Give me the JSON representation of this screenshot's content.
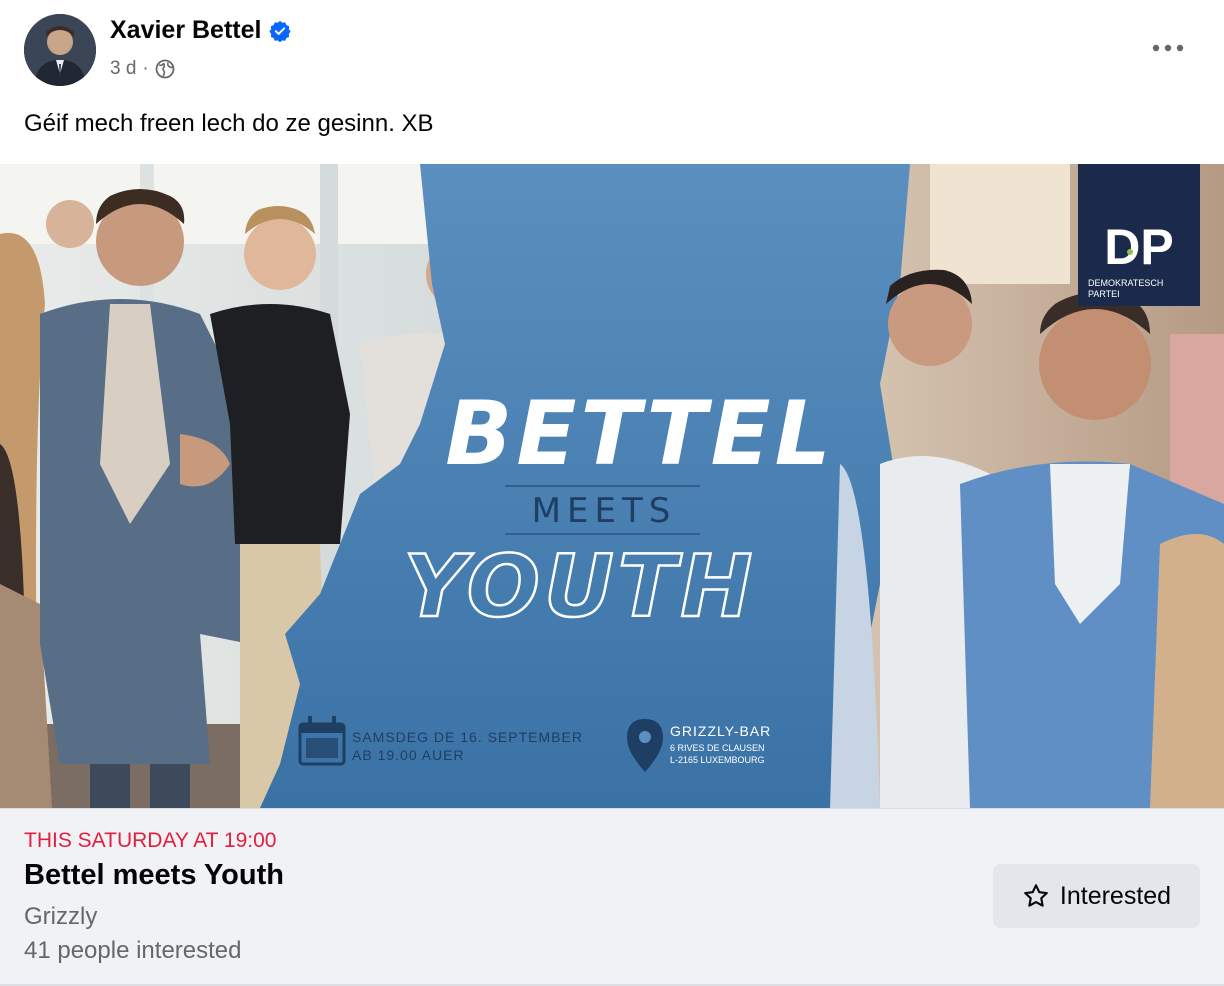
{
  "post": {
    "author": "Xavier Bettel",
    "time": "3 d",
    "separator": "·",
    "caption": "Géif mech freen lech do ze gesinn. XB"
  },
  "icons": {
    "verified": "verified-badge-icon",
    "audience": "globe-icon",
    "more": "more-options-icon",
    "interested": "star-icon"
  },
  "banner": {
    "headline": "BETTEL",
    "middle": "MEETS",
    "bottom": "YOUTH",
    "logo_letters": "DP",
    "logo_line1": "DEMOKRATESCH",
    "logo_line2": "PARTEI",
    "date_line1": "SAMSDEG DE 16. SEPTEMBER",
    "date_line2": "AB 19.00 AUER",
    "venue_line1": "GRIZZLY-BAR",
    "venue_line2": "6 RIVES DE CLAUSEN",
    "venue_line3": "L-2165 LUXEMBOURG"
  },
  "event": {
    "when": "THIS SATURDAY AT 19:00",
    "title": "Bettel meets Youth",
    "venue": "Grizzly",
    "interested_count": "41 people interested",
    "interested_label": "Interested"
  },
  "colors": {
    "accent_red": "#e41e3f",
    "verified_blue": "#0866ff",
    "banner_blue": "#4a80b2",
    "logo_navy": "#1b2a4a"
  }
}
